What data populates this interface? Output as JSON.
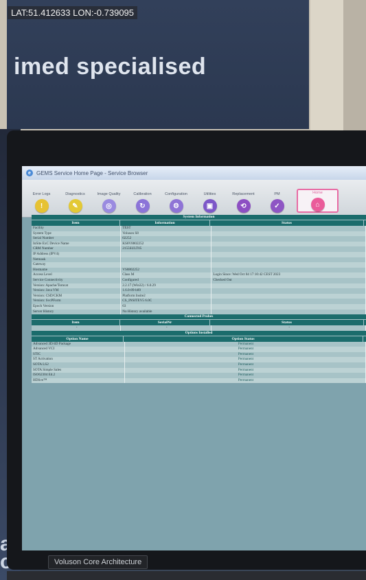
{
  "overlay": {
    "gps": "LAT:51.412633 LON:-0.739095"
  },
  "scene": {
    "banner_text": "imed specialised",
    "monitor_brand": "Voluson Core Architecture",
    "left_letters": "ag\nce"
  },
  "browser": {
    "title": "GEMS Service Home Page - Service Browser"
  },
  "toolbar": [
    {
      "label": "Error Logs",
      "icon": "error-log-icon",
      "color": "#e6c233",
      "glyph": "!"
    },
    {
      "label": "Diagnostics",
      "icon": "diagnostics-icon",
      "color": "#e3c935",
      "glyph": "✎"
    },
    {
      "label": "Image Quality",
      "icon": "image-quality-icon",
      "color": "#9a8be0",
      "glyph": "◎"
    },
    {
      "label": "Calibration",
      "icon": "calibration-icon",
      "color": "#8b74d8",
      "glyph": "↻"
    },
    {
      "label": "Configuration",
      "icon": "configuration-icon",
      "color": "#8f74d6",
      "glyph": "⚙"
    },
    {
      "label": "Utilities",
      "icon": "utilities-icon",
      "color": "#7d57c8",
      "glyph": "▣"
    },
    {
      "label": "Replacement",
      "icon": "replacement-icon",
      "color": "#8d4fc3",
      "glyph": "⟲"
    },
    {
      "label": "PM",
      "icon": "pm-icon",
      "color": "#8e55c4",
      "glyph": "✓"
    },
    {
      "label": "Home",
      "icon": "home-icon",
      "color": "#ea5c9a",
      "glyph": "⌂"
    }
  ],
  "system_info": {
    "title": "System Information",
    "headers": [
      "Item",
      "Information",
      "Status"
    ],
    "rows": [
      [
        "Facility",
        "TEST",
        ""
      ],
      [
        "System Type",
        "Voluson S8",
        ""
      ],
      [
        "Serial Number",
        "02252",
        ""
      ],
      [
        "InSite ExC Device Name",
        "KS8V8802252",
        ""
      ],
      [
        "CRM Number",
        "2155SULT05",
        ""
      ],
      [
        "IP Address (IPV4)",
        "",
        ""
      ],
      [
        "Netmask",
        "",
        ""
      ],
      [
        "Gateway",
        "",
        ""
      ],
      [
        "Hostname",
        "VS8802252",
        ""
      ],
      [
        "Access Level",
        "Class M",
        "Login Since: Wed Oct 04 17:10:42 CEST 2023"
      ],
      [
        "Service Connectivity",
        "Configured",
        "Checked Out"
      ],
      [
        "Version: Apache/Tomcat",
        "2.2.17 (Win32) / 6.0.29",
        ""
      ],
      [
        "Version: Java VM",
        "1.6.0-89-b89",
        ""
      ],
      [
        "Version: CSD/CKM",
        "Platform Insite2",
        ""
      ],
      [
        "Version: SvcPForm",
        "CS_INSITEV5 6.0C",
        ""
      ],
      [
        "Epoch Version",
        "63",
        ""
      ],
      [
        "Server History",
        "No History available",
        ""
      ]
    ]
  },
  "connected_probes": {
    "title": "Connected Probes",
    "headers": [
      "Item",
      "SerialNr",
      "Status"
    ],
    "rows": [
      [
        "-",
        "-",
        "-"
      ]
    ]
  },
  "options": {
    "title": "Options Installed",
    "headers": [
      "Option Name",
      "Option Status"
    ],
    "rows": [
      [
        "Advanced 3D/4D Package",
        "Permanent"
      ],
      [
        "Advanced VCI",
        "Permanent"
      ],
      [
        "STIC",
        "Permanent"
      ],
      [
        "ST Activation",
        "Permanent"
      ],
      [
        "SOTA LS2",
        "Permanent"
      ],
      [
        "SOTA Simple Sales",
        "Permanent"
      ],
      [
        "ISO62304 Ed.2",
        "Permanent"
      ],
      [
        "HDlive™",
        "Permanent"
      ]
    ]
  }
}
